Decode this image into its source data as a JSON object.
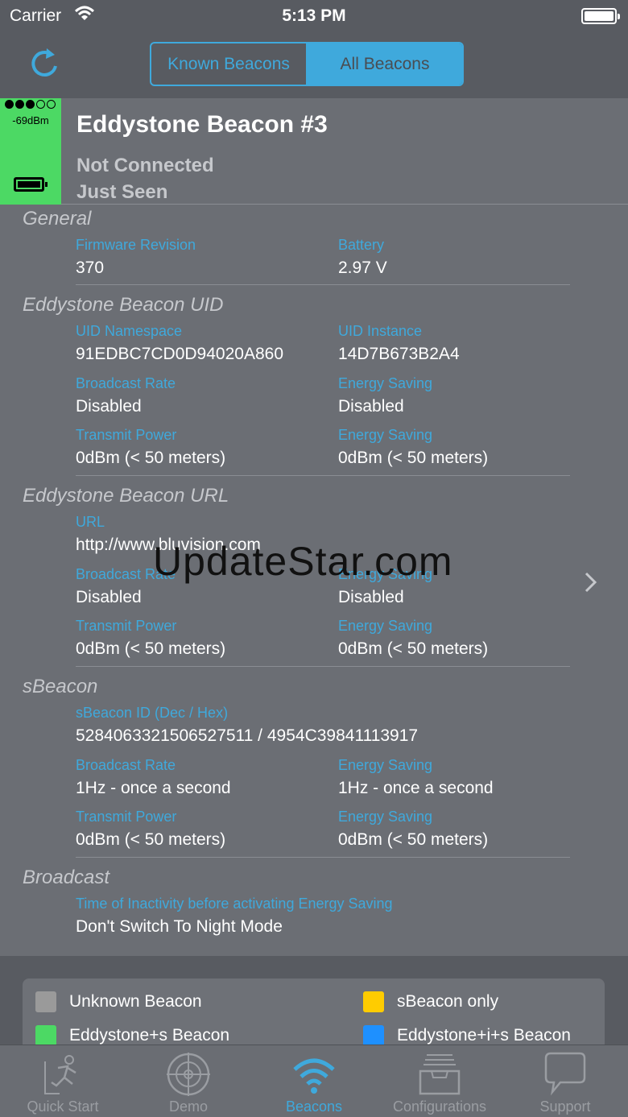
{
  "status_bar": {
    "carrier": "Carrier",
    "time": "5:13 PM"
  },
  "nav": {
    "segments": [
      "Known Beacons",
      "All Beacons"
    ],
    "active_segment": "All Beacons"
  },
  "beacon": {
    "signal_strength": "-69dBm",
    "signal_dots_filled": 3,
    "signal_dots_total": 5,
    "name": "Eddystone Beacon #3",
    "connection": "Not Connected",
    "seen": "Just Seen",
    "header_color": "#4cd964"
  },
  "sections": {
    "general": {
      "title": "General",
      "firmware_label": "Firmware Revision",
      "firmware_value": "370",
      "battery_label": "Battery",
      "battery_value": "2.97 V"
    },
    "uid": {
      "title": "Eddystone Beacon UID",
      "namespace_label": "UID Namespace",
      "namespace_value": "91EDBC7CD0D94020A860",
      "instance_label": "UID Instance",
      "instance_value": "14D7B673B2A4",
      "rate_label": "Broadcast Rate",
      "rate_value": "Disabled",
      "rate_saving_label": "Energy Saving",
      "rate_saving_value": "Disabled",
      "power_label": "Transmit Power",
      "power_value": "0dBm (< 50 meters)",
      "power_saving_label": "Energy Saving",
      "power_saving_value": "0dBm (< 50 meters)"
    },
    "url": {
      "title": "Eddystone Beacon URL",
      "url_label": "URL",
      "url_value": "http://www.bluvision.com",
      "rate_label": "Broadcast Rate",
      "rate_value": "Disabled",
      "rate_saving_label": "Energy Saving",
      "rate_saving_value": "Disabled",
      "power_label": "Transmit Power",
      "power_value": "0dBm (< 50 meters)",
      "power_saving_label": "Energy Saving",
      "power_saving_value": "0dBm (< 50 meters)"
    },
    "sbeacon": {
      "title": "sBeacon",
      "id_label": "sBeacon ID (Dec / Hex)",
      "id_value": "5284063321506527511 / 4954C39841113917",
      "rate_label": "Broadcast Rate",
      "rate_value": "1Hz - once a second",
      "rate_saving_label": "Energy Saving",
      "rate_saving_value": "1Hz - once a second",
      "power_label": "Transmit Power",
      "power_value": "0dBm (< 50 meters)",
      "power_saving_label": "Energy Saving",
      "power_saving_value": "0dBm (< 50 meters)"
    },
    "broadcast": {
      "title": "Broadcast",
      "inactivity_label": "Time of Inactivity before activating Energy Saving",
      "inactivity_value": "Don't Switch To Night Mode"
    }
  },
  "watermark": "UpdateStar.com",
  "legend": [
    {
      "label": "Unknown Beacon",
      "color": "#9a9a9a"
    },
    {
      "label": "sBeacon only",
      "color": "#ffcc00"
    },
    {
      "label": "Eddystone+s Beacon",
      "color": "#4cd964"
    },
    {
      "label": "Eddystone+i+s Beacon",
      "color": "#1e90ff"
    }
  ],
  "tabs": [
    {
      "label": "Quick Start",
      "icon": "runner-icon"
    },
    {
      "label": "Demo",
      "icon": "radar-icon"
    },
    {
      "label": "Beacons",
      "icon": "wifi-icon"
    },
    {
      "label": "Configurations",
      "icon": "tray-icon"
    },
    {
      "label": "Support",
      "icon": "chat-bubble-icon"
    }
  ],
  "active_tab": "Beacons",
  "accent_color": "#3fa9dc"
}
